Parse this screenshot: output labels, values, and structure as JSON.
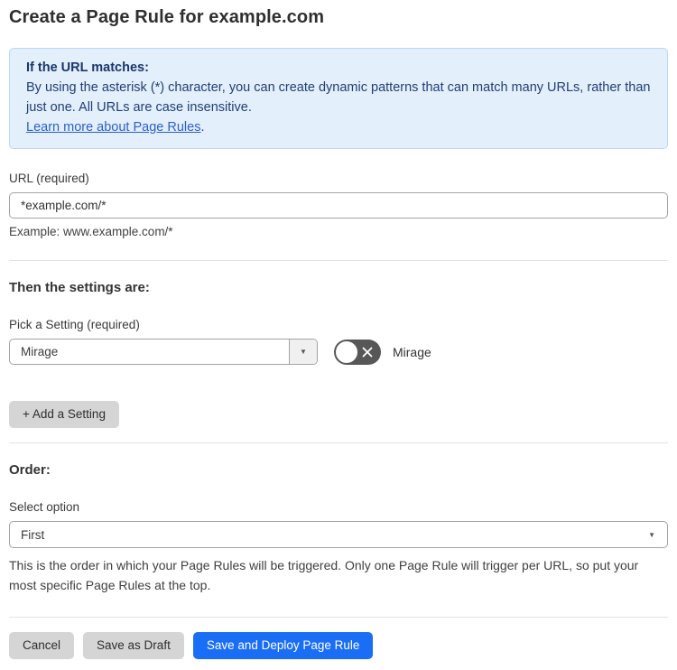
{
  "page": {
    "title": "Create a Page Rule for example.com"
  },
  "info_box": {
    "heading": "If the URL matches:",
    "body": "By using the asterisk (*) character, you can create dynamic patterns that can match many URLs, rather than just one. All URLs are case insensitive.",
    "link_label": "Learn more about Page Rules",
    "link_suffix": "."
  },
  "url_field": {
    "label": "URL (required)",
    "value": "*example.com/*",
    "example": "Example: www.example.com/*"
  },
  "settings_section": {
    "heading": "Then the settings are:",
    "pick_label": "Pick a Setting (required)",
    "selected_setting": "Mirage",
    "dropdown_arrow": "▼",
    "toggle": {
      "state": "off",
      "label": "Mirage"
    },
    "add_button_label": "+ Add a Setting"
  },
  "order_section": {
    "heading": "Order:",
    "select_label": "Select option",
    "selected_option": "First",
    "dropdown_arrow": "▼",
    "help_text": "This is the order in which your Page Rules will be triggered. Only one Page Rule will trigger per URL, so put your most specific Page Rules at the top."
  },
  "footer": {
    "cancel_label": "Cancel",
    "save_draft_label": "Save as Draft",
    "save_deploy_label": "Save and Deploy Page Rule"
  },
  "colors": {
    "accent_blue": "#1a6ef5",
    "info_bg": "#e4effc",
    "info_border": "#bcd7f3",
    "info_text": "#1f3f74",
    "link_blue": "#2b61cb",
    "button_gray": "#d5d5d5",
    "toggle_off_gray": "#575757"
  }
}
